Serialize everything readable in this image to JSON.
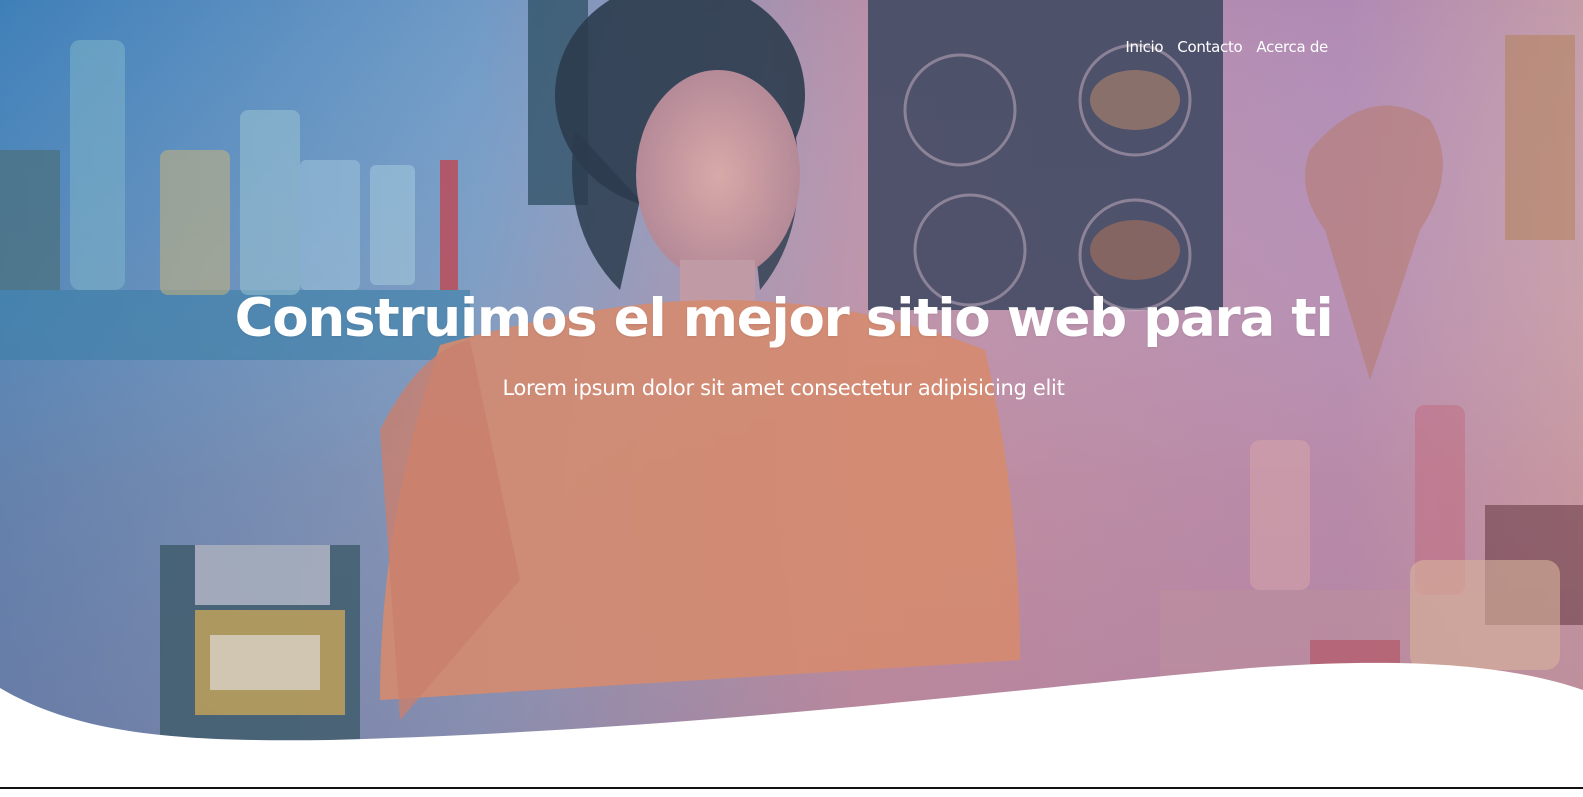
{
  "nav": {
    "items": [
      {
        "label": "Inicio"
      },
      {
        "label": "Contacto"
      },
      {
        "label": "Acerca de"
      }
    ]
  },
  "hero": {
    "title": "Construimos el mejor sitio web para ti",
    "subtitle": "Lorem ipsum dolor sit amet consectetur adipisicing elit",
    "background_image": "woman-in-retro-diner-photo",
    "overlay_colors": [
      "#3f7fb8",
      "#b47ea9",
      "#c29aa3"
    ]
  }
}
